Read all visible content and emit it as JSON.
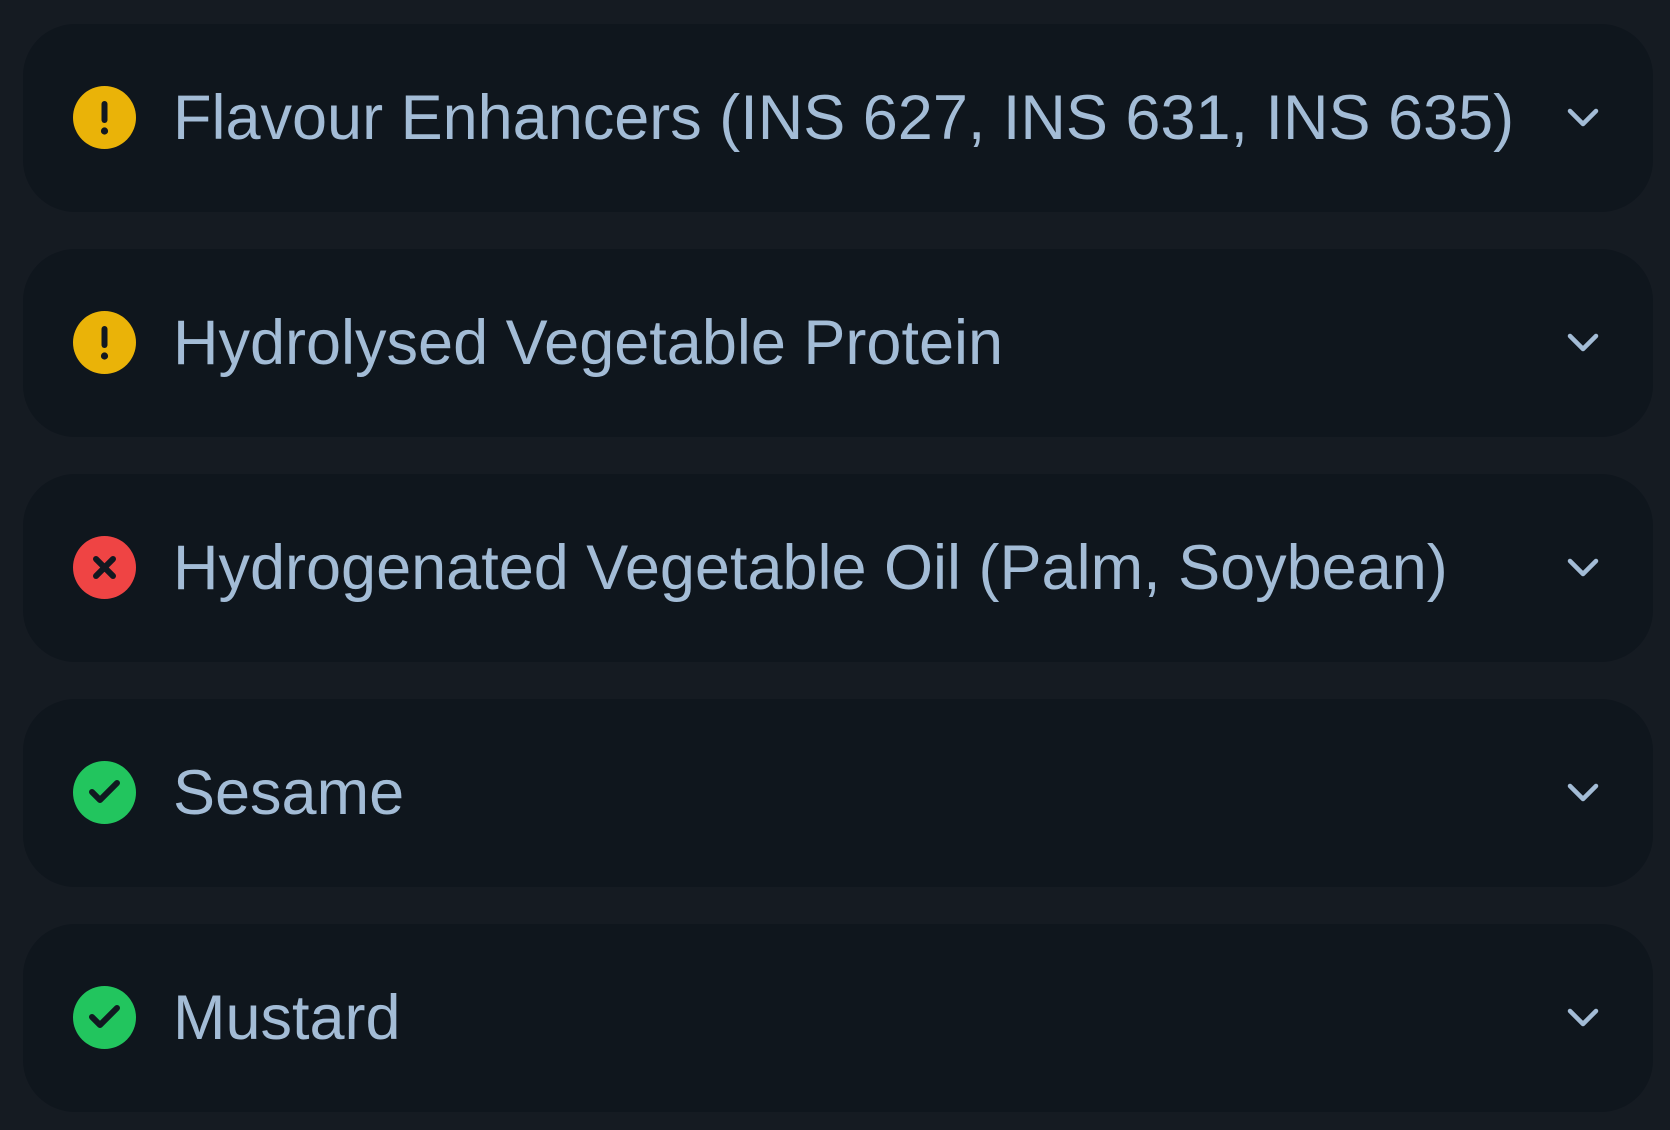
{
  "colors": {
    "background": "#151b22",
    "row_background": "#0f161d",
    "text": "#a3bcd6",
    "warning": "#eab308",
    "danger": "#ef4444",
    "safe": "#22c55e",
    "icon_glyph": "#111820"
  },
  "items": [
    {
      "label": "Flavour Enhancers (INS 627, INS 631, INS 635)",
      "status": "warning",
      "status_icon": "exclamation-icon"
    },
    {
      "label": "Hydrolysed Vegetable Protein",
      "status": "warning",
      "status_icon": "exclamation-icon"
    },
    {
      "label": "Hydrogenated Vegetable Oil (Palm, Soybean)",
      "status": "danger",
      "status_icon": "x-icon"
    },
    {
      "label": "Sesame",
      "status": "safe",
      "status_icon": "check-icon"
    },
    {
      "label": "Mustard",
      "status": "safe",
      "status_icon": "check-icon"
    }
  ]
}
